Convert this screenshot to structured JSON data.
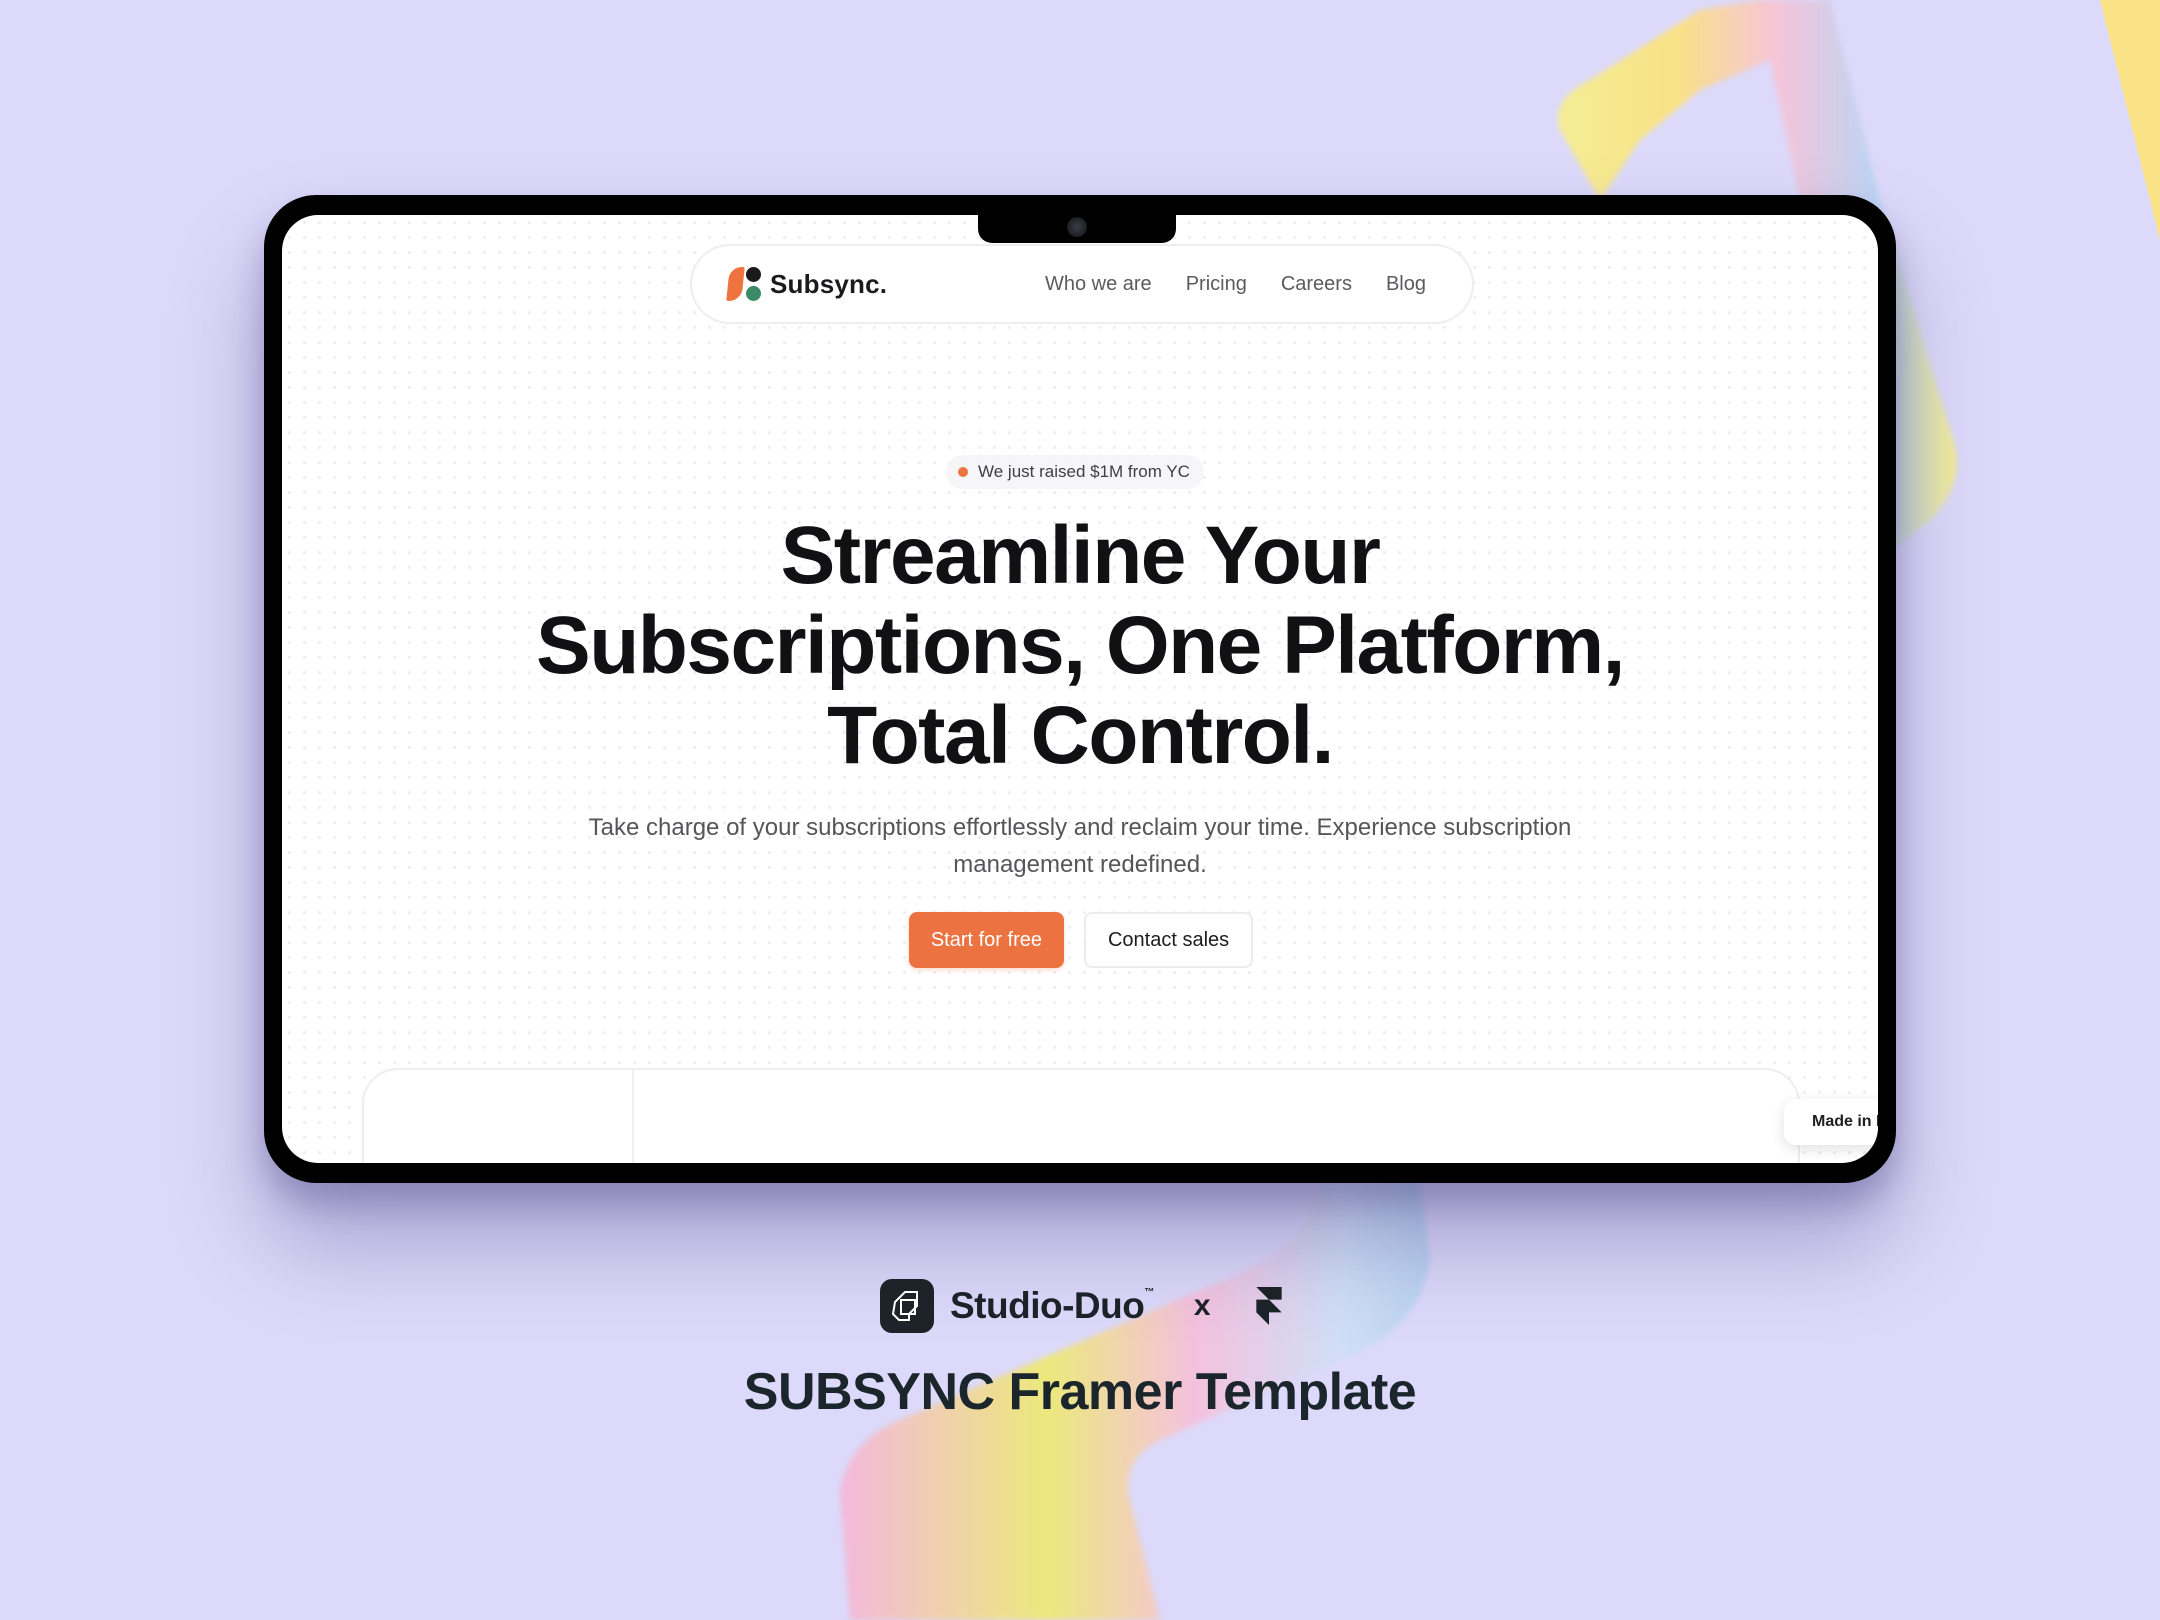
{
  "colors": {
    "background": "#dcd9fa",
    "accent_orange": "#ec7341",
    "logo_green": "#3b8a68",
    "logo_dark": "#1a1a1c",
    "text_dark": "#111114"
  },
  "navbar": {
    "logo_text": "Subsync.",
    "links": [
      {
        "label": "Who we are"
      },
      {
        "label": "Pricing"
      },
      {
        "label": "Careers"
      },
      {
        "label": "Blog"
      }
    ]
  },
  "hero": {
    "badge": "We just raised $1M from YC",
    "headline_lines": [
      "Streamline Your",
      "Subscriptions, One Platform,",
      "Total Control."
    ],
    "subheadline": "Take charge of your subscriptions effortlessly and reclaim your time. Experience subscription management redefined.",
    "primary_cta": "Start for free",
    "secondary_cta": "Contact sales"
  },
  "made_in_badge": "Made in Framer",
  "branding": {
    "studio_name": "Studio-Duo",
    "trademark": "™",
    "cross": "x",
    "template_title": "SUBSYNC Framer Template"
  }
}
